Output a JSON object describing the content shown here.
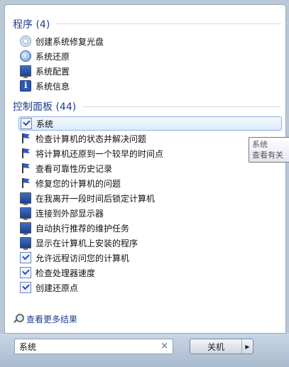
{
  "programs": {
    "header": "程序 (4)",
    "items": [
      {
        "label": "创建系统修复光盘",
        "icon": "disc-icon"
      },
      {
        "label": "系统还原",
        "icon": "restore-clock-icon"
      },
      {
        "label": "系统配置",
        "icon": "config-icon"
      },
      {
        "label": "系统信息",
        "icon": "info-icon"
      }
    ]
  },
  "control_panel": {
    "header": "控制面板 (44)",
    "items": [
      {
        "label": "系统",
        "icon": "system-check-icon",
        "selected": true
      },
      {
        "label": "检查计算机的状态并解决问题",
        "icon": "flag-icon"
      },
      {
        "label": "将计算机还原到一个较早的时间点",
        "icon": "flag-icon"
      },
      {
        "label": "查看可靠性历史记录",
        "icon": "flag-icon"
      },
      {
        "label": "修复您的计算机的问题",
        "icon": "flag-icon"
      },
      {
        "label": "在我离开一段时间后锁定计算机",
        "icon": "monitor-icon"
      },
      {
        "label": "连接到外部显示器",
        "icon": "monitor-icon"
      },
      {
        "label": "自动执行推荐的维护任务",
        "icon": "monitor-icon"
      },
      {
        "label": "显示在计算机上安装的程序",
        "icon": "monitor-icon"
      },
      {
        "label": "允许远程访问您的计算机",
        "icon": "system-check-icon"
      },
      {
        "label": "检查处理器速度",
        "icon": "system-check-icon"
      },
      {
        "label": "创建还原点",
        "icon": "system-check-icon"
      }
    ]
  },
  "tooltip": {
    "title": "系统",
    "body": "查看有关"
  },
  "see_more": "查看更多结果",
  "search": {
    "value": "系统",
    "clear": "×"
  },
  "shutdown": {
    "label": "关机",
    "arrow": "▶"
  }
}
